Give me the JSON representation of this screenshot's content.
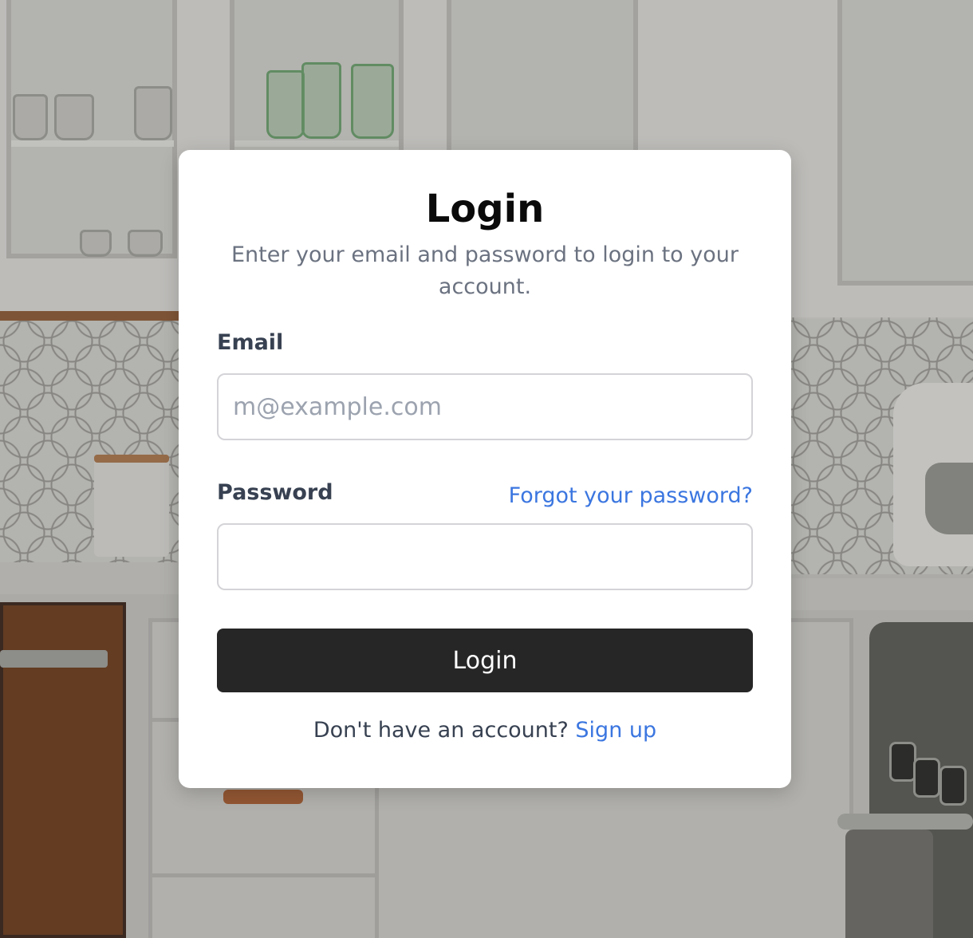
{
  "login_card": {
    "title": "Login",
    "subtitle": "Enter your email and password to login to your account.",
    "email": {
      "label": "Email",
      "placeholder": "m@example.com",
      "value": ""
    },
    "password": {
      "label": "Password",
      "value": "",
      "forgot_link": "Forgot your password?"
    },
    "submit_label": "Login",
    "footer": {
      "prompt": "Don't have an account?",
      "signup_link": "Sign up"
    }
  },
  "colors": {
    "accent_link": "#3b76e0",
    "button_bg": "#262626",
    "card_bg": "#ffffff"
  }
}
